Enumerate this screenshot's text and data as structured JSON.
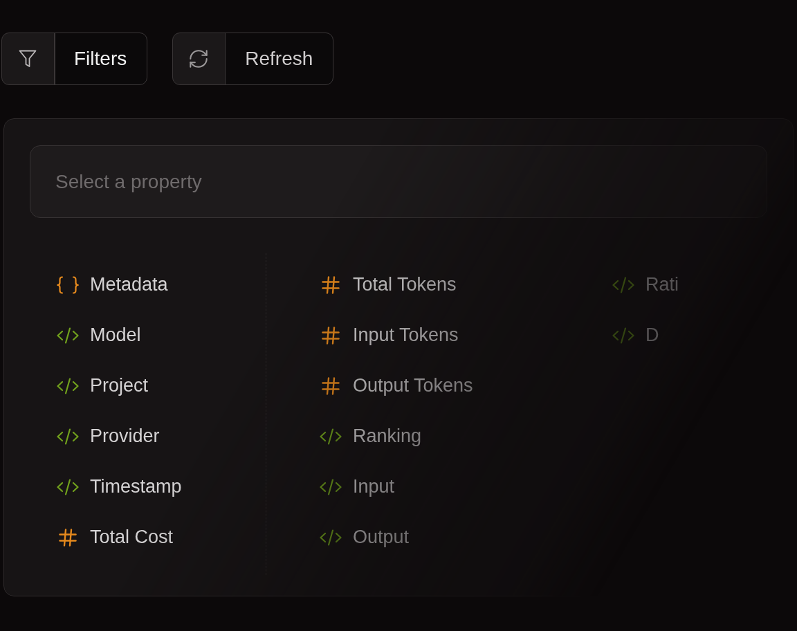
{
  "toolbar": {
    "buttons": [
      {
        "label": "Filters",
        "kind": "filter"
      },
      {
        "label": "Refresh",
        "kind": "refresh"
      }
    ]
  },
  "property_picker": {
    "search": {
      "placeholder": "Select a property"
    },
    "columns": [
      {
        "items": [
          {
            "label": "Metadata",
            "kind": "object"
          },
          {
            "label": "Model",
            "kind": "string"
          },
          {
            "label": "Project",
            "kind": "string"
          },
          {
            "label": "Provider",
            "kind": "string"
          },
          {
            "label": "Timestamp",
            "kind": "string"
          },
          {
            "label": "Total Cost",
            "kind": "number"
          }
        ]
      },
      {
        "items": [
          {
            "label": "Total Tokens",
            "kind": "number"
          },
          {
            "label": "Input Tokens",
            "kind": "number"
          },
          {
            "label": "Output Tokens",
            "kind": "number"
          },
          {
            "label": "Ranking",
            "kind": "string"
          },
          {
            "label": "Input",
            "kind": "string"
          },
          {
            "label": "Output",
            "kind": "string"
          }
        ]
      },
      {
        "items": [
          {
            "label": "Rati",
            "kind": "string"
          },
          {
            "label": "D",
            "kind": "string"
          }
        ]
      }
    ]
  }
}
